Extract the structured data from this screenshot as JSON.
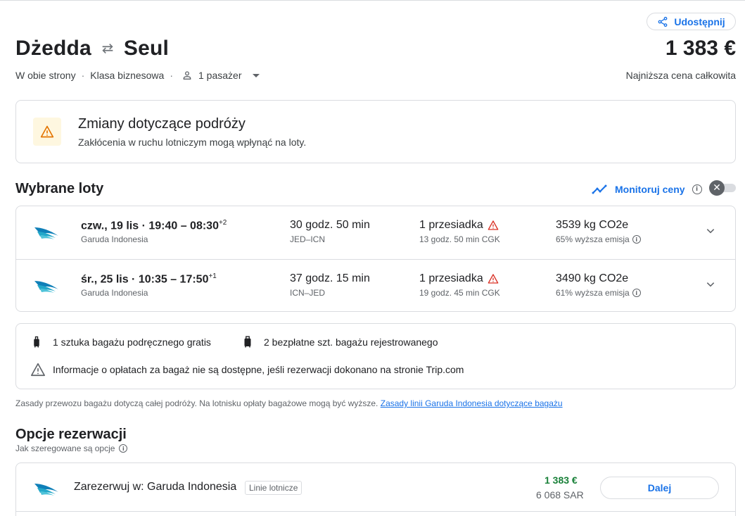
{
  "header": {
    "share_label": "Udostępnij",
    "origin": "Dżedda",
    "destination": "Seul",
    "price": "1 383 €",
    "price_note": "Najniższa cena całkowita",
    "trip_type": "W obie strony",
    "cabin": "Klasa biznesowa",
    "passengers": "1 pasażer"
  },
  "alert": {
    "title": "Zmiany dotyczące podróży",
    "text": "Zakłócenia w ruchu lotniczym mogą wpłynąć na loty."
  },
  "selected": {
    "title": "Wybrane loty",
    "track_label": "Monitoruj ceny",
    "flights": [
      {
        "times": "czw., 19 lis  ·  19:40 – 08:30",
        "day_offset": "+2",
        "airline": "Garuda Indonesia",
        "duration": "30 godz. 50 min",
        "route": "JED–ICN",
        "stops": "1 przesiadka",
        "layover": "13 godz. 50 min CGK",
        "co2": "3539 kg CO2e",
        "emissions": "65% wyższa emisja"
      },
      {
        "times": "śr., 25 lis  ·  10:35 – 17:50",
        "day_offset": "+1",
        "airline": "Garuda Indonesia",
        "duration": "37 godz. 15 min",
        "route": "ICN–JED",
        "stops": "1 przesiadka",
        "layover": "19 godz. 45 min CGK",
        "co2": "3490 kg CO2e",
        "emissions": "61% wyższa emisja"
      }
    ]
  },
  "baggage": {
    "carry_on": "1 sztuka bagażu podręcznego gratis",
    "checked": "2 bezpłatne szt. bagażu rejestrowanego",
    "warning": "Informacje o opłatach za bagaż nie są dostępne, jeśli rezerwacji dokonano na stronie Trip.com",
    "fine_print": "Zasady przewozu bagażu dotyczą całej podróży. Na lotnisku opłaty bagażowe mogą być wyższe.",
    "policy_link": "Zasady linii Garuda Indonesia dotyczące bagażu"
  },
  "booking": {
    "title": "Opcje rezerwacji",
    "subtitle": "Jak szeregowane są opcje",
    "options": [
      {
        "label": "Zarezerwuj w: Garuda Indonesia",
        "chip": "Linie lotnicze",
        "price": "1 383 €",
        "price_local": "6 068 SAR",
        "button": "Dalej"
      }
    ]
  },
  "colors": {
    "accent": "#1a73e8",
    "price_green": "#188038",
    "warning_red": "#d93025",
    "warning_amber": "#e37400",
    "border": "#dadce0"
  }
}
